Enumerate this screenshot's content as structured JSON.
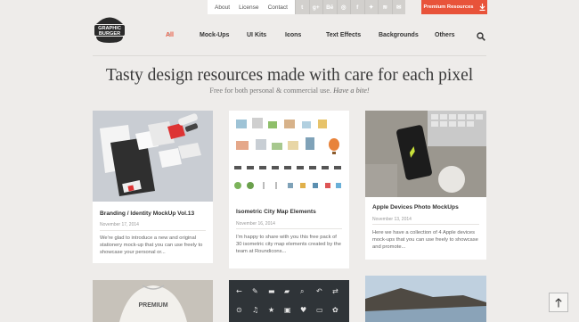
{
  "topbar": {
    "links": [
      "About",
      "License",
      "Contact"
    ],
    "social_icons": [
      {
        "name": "tumblr-icon",
        "glyph": "t"
      },
      {
        "name": "google-plus-icon",
        "glyph": "g+"
      },
      {
        "name": "behance-icon",
        "glyph": "Bē"
      },
      {
        "name": "dribbble-icon",
        "glyph": "◎"
      },
      {
        "name": "facebook-icon",
        "glyph": "f"
      },
      {
        "name": "twitter-icon",
        "glyph": "✦"
      },
      {
        "name": "rss-icon",
        "glyph": "≋"
      },
      {
        "name": "email-icon",
        "glyph": "✉"
      }
    ],
    "premium_label": "Premium Resources"
  },
  "logo": {
    "line1": "GRAPHIC",
    "line2": "BURGER"
  },
  "nav": {
    "items": [
      "All",
      "Mock-Ups",
      "UI Kits",
      "Icons",
      "Text Effects",
      "Backgrounds",
      "Others"
    ],
    "active": "All"
  },
  "hero": {
    "headline": "Tasty design resources made with care for each pixel",
    "subline": "Free for both personal & commercial use.",
    "subline_em": "Have a bite!"
  },
  "cards": [
    {
      "title": "Branding / Identity MockUp Vol.13",
      "date": "November 17, 2014",
      "excerpt": "We're glad to introduce a new and original stationery mock-up that you can use freely to showcase your personal or..."
    },
    {
      "title": "Isometric City Map Elements",
      "date": "November 16, 2014",
      "excerpt": "I'm happy to share with you this free pack of 30 isometric city map elements created by the team at Roundicons..."
    },
    {
      "title": "Apple Devices Photo MockUps",
      "date": "November 13, 2014",
      "excerpt": "Here we have a collection of 4 Apple devices mock-ups that you can use freely to showcase and promote..."
    }
  ],
  "bottom_cards": [
    {
      "label": "PREMIUM"
    }
  ],
  "colors": {
    "accent": "#e8533a",
    "background": "#eeecea",
    "card": "#ffffff"
  }
}
